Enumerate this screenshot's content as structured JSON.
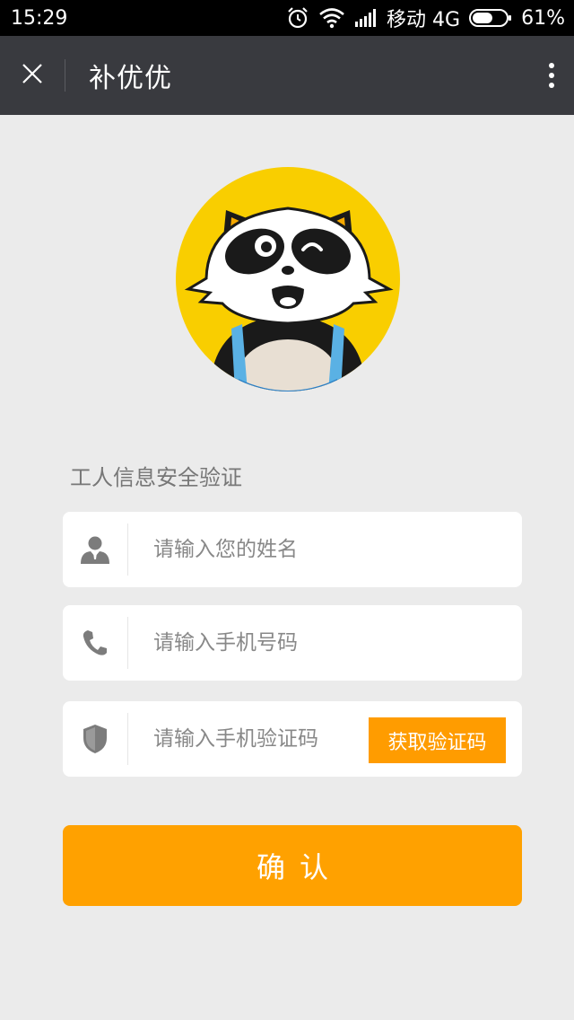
{
  "status_bar": {
    "time": "15:29",
    "carrier": "移动 4G",
    "battery": "61%",
    "battery_level": 0.61,
    "icons": [
      "alarm-icon",
      "wifi-icon",
      "signal-icon",
      "battery-icon"
    ]
  },
  "nav": {
    "title": "补优优",
    "close_icon": "close-icon",
    "more_icon": "more-vertical-icon"
  },
  "form": {
    "heading": "工人信息安全验证",
    "name_placeholder": "请输入您的姓名",
    "phone_placeholder": "请输入手机号码",
    "code_placeholder": "请输入手机验证码",
    "get_code_label": "获取验证码",
    "confirm_label": "确认"
  },
  "colors": {
    "nav_bg": "#393a3f",
    "accent": "#ffa100",
    "page_bg": "#ebebeb",
    "mascot_bg": "#f9ce00"
  }
}
